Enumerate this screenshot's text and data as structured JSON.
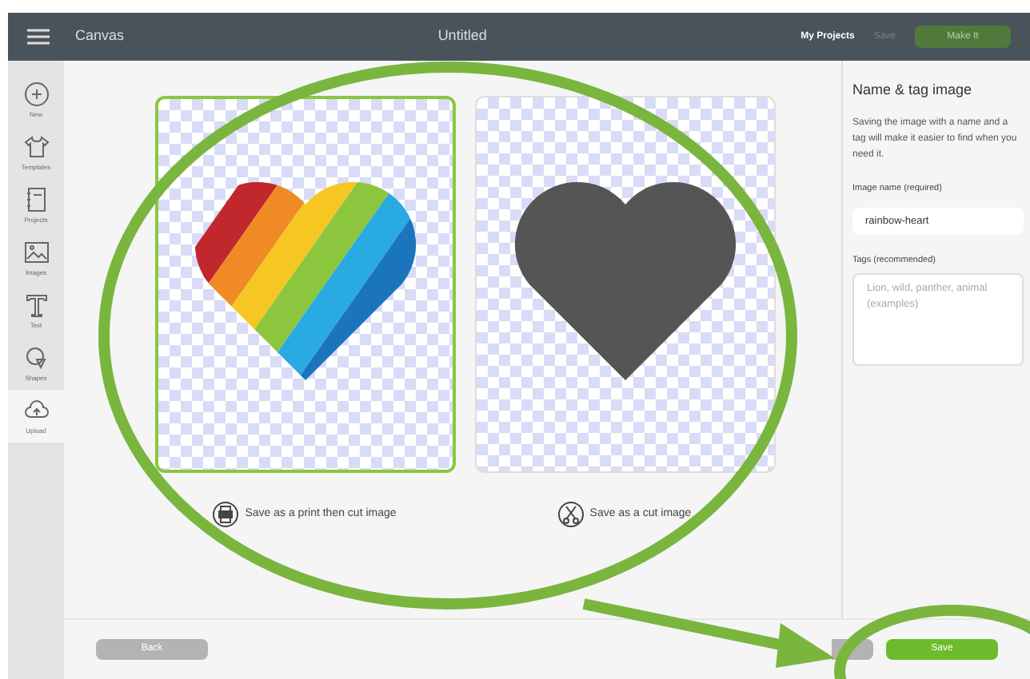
{
  "top_bar": {
    "app_name": "Canvas",
    "document_title": "Untitled",
    "my_projects": "My Projects",
    "save": {
      "label": "Save",
      "disabled": true
    },
    "make_it": {
      "label": "Make It",
      "disabled": true
    }
  },
  "sidebar": {
    "items": [
      {
        "label": "New",
        "kind": "plus",
        "selected": false
      },
      {
        "label": "Templates",
        "kind": "shirt",
        "selected": false
      },
      {
        "label": "Projects",
        "kind": "notebook",
        "selected": false
      },
      {
        "label": "Images",
        "kind": "image",
        "selected": false
      },
      {
        "label": "Text",
        "kind": "text",
        "selected": false
      },
      {
        "label": "Shapes",
        "kind": "shapes",
        "selected": false
      },
      {
        "label": "Upload",
        "kind": "upload",
        "selected": true
      }
    ]
  },
  "options": [
    {
      "kind": "print_then_cut",
      "label": "Save as a print then cut image",
      "selected": true
    },
    {
      "kind": "cut",
      "label": "Save as a cut image",
      "selected": false
    }
  ],
  "panel": {
    "title": "Name & tag image",
    "description": "Saving the image with a name and a tag will make it easier to find when you need it.",
    "name_label": "Image name (required)",
    "name_value": "rainbow-heart",
    "tags_label": "Tags (recommended)",
    "tags_placeholder": "Lion, wild, panther, animal (examples)"
  },
  "footer": {
    "back": "Back",
    "save": {
      "label": "Save",
      "disabled": false
    }
  }
}
